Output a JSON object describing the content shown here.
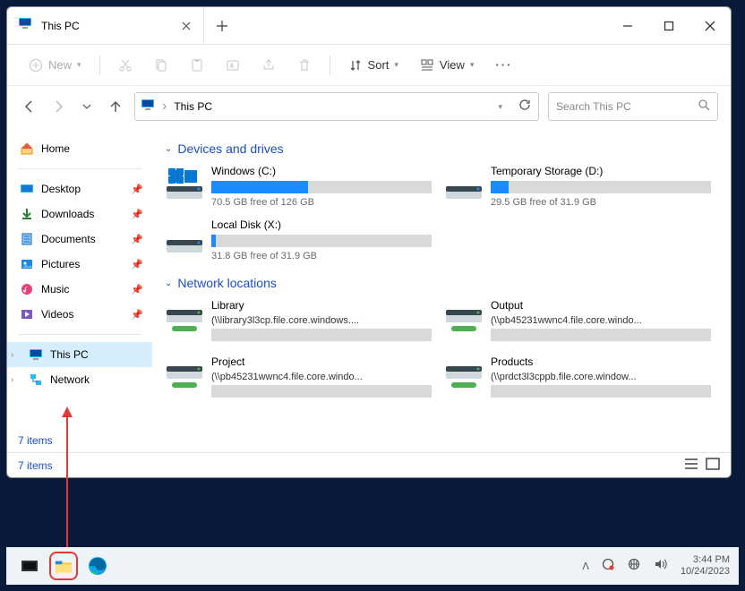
{
  "tab_title": "This PC",
  "toolbar": {
    "new": "New",
    "sort": "Sort",
    "view": "View"
  },
  "address": {
    "location": "This PC"
  },
  "search": {
    "placeholder": "Search This PC"
  },
  "sidebar": {
    "home": "Home",
    "desktop": "Desktop",
    "downloads": "Downloads",
    "documents": "Documents",
    "pictures": "Pictures",
    "music": "Music",
    "videos": "Videos",
    "this_pc": "This PC",
    "network": "Network"
  },
  "groups": {
    "devices": "Devices and drives",
    "network": "Network locations"
  },
  "drives": [
    {
      "name": "Windows (C:)",
      "free": "70.5 GB free of 126 GB",
      "fill": 44,
      "accent": "#1a8cff",
      "os": true
    },
    {
      "name": "Temporary Storage (D:)",
      "free": "29.5 GB free of 31.9 GB",
      "fill": 8,
      "accent": "#1a8cff",
      "os": false
    },
    {
      "name": "Local Disk (X:)",
      "free": "31.8 GB free of 31.9 GB",
      "fill": 2,
      "accent": "#1a8cff",
      "os": false
    }
  ],
  "net_locations": [
    {
      "name": "Library",
      "path": "(\\\\library3l3cp.file.core.windows...."
    },
    {
      "name": "Output",
      "path": "(\\\\pb45231wwnc4.file.core.windo..."
    },
    {
      "name": "Project",
      "path": "(\\\\pb45231wwnc4.file.core.windo..."
    },
    {
      "name": "Products",
      "path": "(\\\\prdct3l3cppb.file.core.window..."
    }
  ],
  "status": "7 items",
  "clock": {
    "time": "3:44 PM",
    "date": "10/24/2023"
  }
}
